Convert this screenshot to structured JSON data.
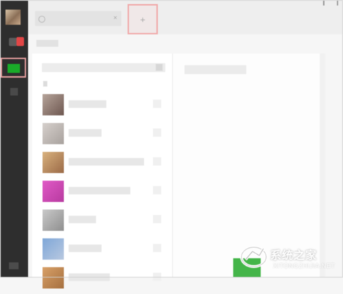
{
  "window": {
    "title": ""
  },
  "rail": {
    "avatar_colors": [
      "#d8c3a6",
      "#8b6f57"
    ],
    "badge_color": "#e24646",
    "active_icon_color": "#1aab29",
    "items": [
      "chat-icon",
      "contacts-icon",
      "favorites-icon",
      "menu-icon"
    ]
  },
  "header": {
    "search_placeholder": "",
    "add_button_label": "+",
    "clear_label": "×",
    "highlight_color": "#f0a8a8"
  },
  "contacts": [
    {
      "name": "",
      "avatar": [
        "#b6a49a",
        "#6e5750"
      ],
      "name_width": 55
    },
    {
      "name": "",
      "avatar": [
        "#d6d0cc",
        "#a8a19d"
      ],
      "name_width": 48
    },
    {
      "name": "",
      "avatar": [
        "#d9b27e",
        "#9b6a47"
      ],
      "name_width": 110
    },
    {
      "name": "",
      "avatar": [
        "#e05ac6",
        "#b83aa0"
      ],
      "name_width": 90
    },
    {
      "name": "",
      "avatar": [
        "#c9c9c9",
        "#8f8f8f"
      ],
      "name_width": 40
    },
    {
      "name": "",
      "avatar": [
        "#7fa7d8",
        "#b8c8e0"
      ],
      "name_width": 48
    },
    {
      "name": "",
      "avatar": [
        "#d8a068",
        "#a6703f"
      ],
      "name_width": 60
    }
  ],
  "detail": {
    "title": "",
    "send_color": "#44b549"
  },
  "watermark": {
    "brand": "系统之家",
    "url": "XITONGZHIJIA.NET"
  }
}
